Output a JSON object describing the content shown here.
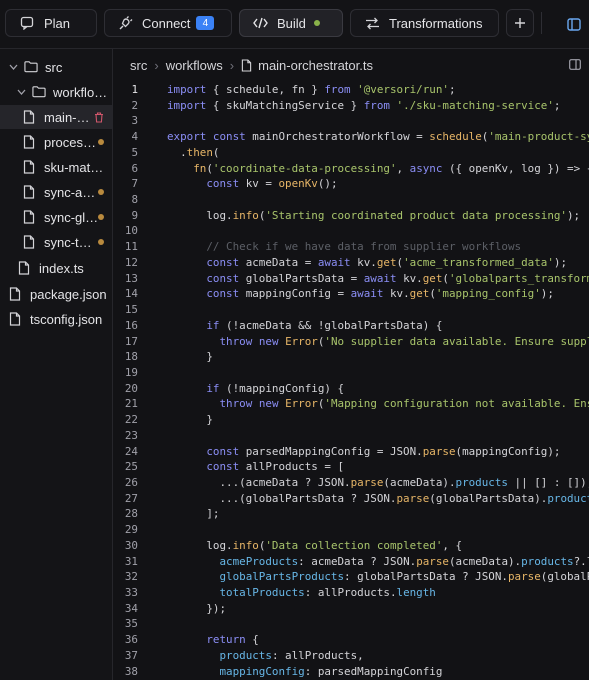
{
  "topbar": {
    "tabs": [
      {
        "label": "Plan",
        "icon": "chat-bubble-icon"
      },
      {
        "label": "Connect",
        "icon": "plug-icon",
        "badge": "4"
      },
      {
        "label": "Build",
        "icon": "code-icon",
        "status": "active-dot"
      },
      {
        "label": "Transformations",
        "icon": "swap-arrows-icon"
      }
    ],
    "add_icon": "plus-icon",
    "layout_icon": "panel-layout-icon"
  },
  "sidebar": {
    "items": [
      {
        "label": "src",
        "kind": "folder",
        "open": true
      },
      {
        "label": "workflo…",
        "kind": "folder",
        "open": true
      },
      {
        "label": "main-…",
        "kind": "file",
        "selected": true,
        "mark": "trash-icon"
      },
      {
        "label": "proces…",
        "kind": "file",
        "mark": "modified-dot"
      },
      {
        "label": "sku-mat…",
        "kind": "file"
      },
      {
        "label": "sync-a…",
        "kind": "file",
        "mark": "modified-dot"
      },
      {
        "label": "sync-gl…",
        "kind": "file",
        "mark": "modified-dot"
      },
      {
        "label": "sync-t…",
        "kind": "file",
        "mark": "modified-dot"
      },
      {
        "label": "index.ts",
        "kind": "file"
      },
      {
        "label": "package.json",
        "kind": "file"
      },
      {
        "label": "tsconfig.json",
        "kind": "file"
      }
    ]
  },
  "editor": {
    "breadcrumb": [
      "src",
      "workflows",
      "main-orchestrator.ts"
    ],
    "current_line": 1,
    "lines": [
      "import { schedule, fn } from '@versori/run';",
      "import { skuMatchingService } from './sku-matching-service';",
      "",
      "export const mainOrchestratorWorkflow = schedule('main-product-sync",
      "  .then(",
      "    fn('coordinate-data-processing', async ({ openKv, log }) => {",
      "      const kv = openKv();",
      "",
      "      log.info('Starting coordinated product data processing');",
      "",
      "      // Check if we have data from supplier workflows",
      "      const acmeData = await kv.get('acme_transformed_data');",
      "      const globalPartsData = await kv.get('globalparts_transformed",
      "      const mappingConfig = await kv.get('mapping_config');",
      "",
      "      if (!acmeData && !globalPartsData) {",
      "        throw new Error('No supplier data available. Ensure supplie",
      "      }",
      "",
      "      if (!mappingConfig) {",
      "        throw new Error('Mapping configuration not available. Ensur",
      "      }",
      "",
      "      const parsedMappingConfig = JSON.parse(mappingConfig);",
      "      const allProducts = [",
      "        ...(acmeData ? JSON.parse(acmeData).products || [] : []),",
      "        ...(globalPartsData ? JSON.parse(globalPartsData).products",
      "      ];",
      "",
      "      log.info('Data collection completed', {",
      "        acmeProducts: acmeData ? JSON.parse(acmeData).products?.len",
      "        globalPartsProducts: globalPartsData ? JSON.parse(globalPar",
      "        totalProducts: allProducts.length",
      "      });",
      "",
      "      return {",
      "        products: allProducts,",
      "        mappingConfig: parsedMappingConfig"
    ]
  },
  "colors": {
    "keyword": "#8b8ef5",
    "function": "#e6b567",
    "string": "#a8c46b",
    "property": "#67b6e6",
    "comment": "#5c5f66",
    "badge": "#3b82f6",
    "active_dot": "#8ab34a",
    "modified_dot": "#b98a3e"
  }
}
